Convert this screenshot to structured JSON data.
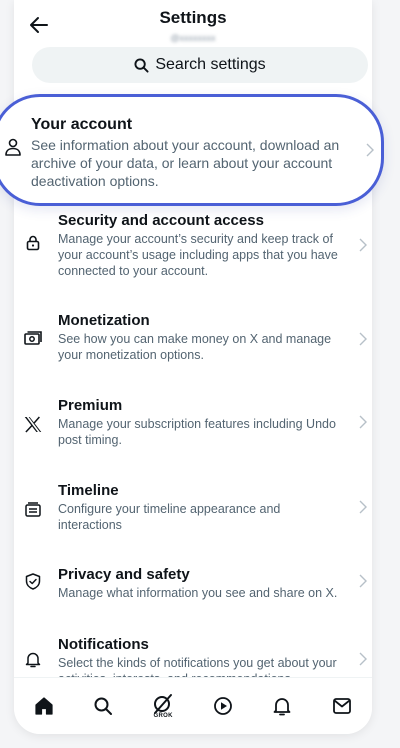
{
  "header": {
    "title": "Settings",
    "handle": "@xxxxxxxx"
  },
  "search": {
    "placeholder": "Search settings"
  },
  "menu": [
    {
      "title": "Your account",
      "description": "See information about your account, download an archive of your data, or learn about your account deactivation options.",
      "icon": "person-icon"
    },
    {
      "title": "Security and account access",
      "description": "Manage your account’s security and keep track of your account’s usage including apps that you have connected to your account.",
      "icon": "lock-icon"
    },
    {
      "title": "Monetization",
      "description": "See how you can make money on X and manage your monetization options.",
      "icon": "money-icon"
    },
    {
      "title": "Premium",
      "description": "Manage your subscription features including Undo post timing.",
      "icon": "x-logo-icon"
    },
    {
      "title": "Timeline",
      "description": "Configure your timeline appearance and interactions",
      "icon": "timeline-icon"
    },
    {
      "title": "Privacy and safety",
      "description": "Manage what information you see and share on X.",
      "icon": "shield-check-icon"
    },
    {
      "title": "Notifications",
      "description": "Select the kinds of notifications you get about your activities, interests, and recommendations.",
      "icon": "bell-icon"
    }
  ],
  "bottom_nav": {
    "items": [
      "home-icon",
      "search-icon",
      "grok-icon",
      "play-icon",
      "bell-icon",
      "mail-icon"
    ],
    "grok_label": "GROK"
  },
  "colors": {
    "highlight_border": "#4a5fd6",
    "text_primary": "#0f1419",
    "text_secondary": "#536471",
    "search_bg": "#eff3f4"
  }
}
